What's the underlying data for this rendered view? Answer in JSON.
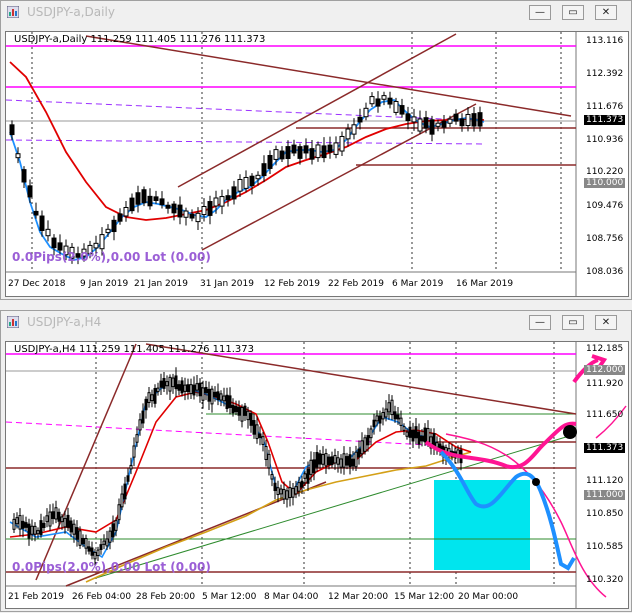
{
  "windows": [
    {
      "title": "USDJPY-a,Daily",
      "symbol_line": "USDJPY-a,Daily  111.259 111.405 111.276 111.373",
      "pips_text": "0.0Pips(2.0%),0.00 Lot (0.00)",
      "prices": [
        "113.116",
        "112.392",
        "111.676",
        "111.373",
        "110.936",
        "110.220",
        "110.000",
        "109.476",
        "108.756",
        "108.036"
      ],
      "highlight": [
        "111.373",
        "110.000"
      ],
      "time_labels": [
        "27 Dec 2018",
        "9 Jan 2019",
        "21 Jan 2019",
        "31 Jan 2019",
        "12 Feb 2019",
        "22 Feb 2019",
        "6 Mar 2019",
        "16 Mar 2019"
      ]
    },
    {
      "title": "USDJPY-a,H4",
      "symbol_line": "USDJPY-a,H4  111.259 111.405 111.276 111.373",
      "pips_text": "0.0Pips(2.0%),0.00 Lot (0.00)",
      "prices": [
        "112.185",
        "111.920",
        "111.650",
        "111.373",
        "111.120",
        "111.000",
        "110.850",
        "110.585",
        "110.320"
      ],
      "highlight": [
        "111.373",
        "111.000"
      ],
      "highlight_top": "112.000",
      "time_labels": [
        "21 Feb 2019",
        "26 Feb 04:00",
        "28 Feb 20:00",
        "5 Mar 12:00",
        "8 Mar 04:00",
        "12 Mar 20:00",
        "15 Mar 12:00",
        "20 Mar 00:00"
      ]
    }
  ],
  "buttons": {
    "minimize": "—",
    "restore": "▭",
    "close": "✕"
  },
  "colors": {
    "up_candle": "#ffffff",
    "down_candle": "#000000",
    "ma_fast": "#1e90ff",
    "ma_slow": "#e00000",
    "hline": "#ff00ff",
    "channel": "#8b2a2a",
    "drawing": "#ff1493",
    "box": "#00e5ee",
    "ema_long": "#d4a017"
  }
}
